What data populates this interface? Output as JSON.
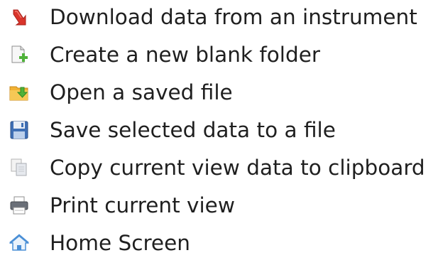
{
  "menu": {
    "items": [
      {
        "label": "Download data from an instrument",
        "icon": "download-arrow-icon"
      },
      {
        "label": "Create a new blank folder",
        "icon": "new-document-icon"
      },
      {
        "label": "Open a saved file",
        "icon": "open-folder-icon"
      },
      {
        "label": "Save selected data to a file",
        "icon": "floppy-disk-icon"
      },
      {
        "label": "Copy current view data to clipboard",
        "icon": "copy-icon"
      },
      {
        "label": "Print current view",
        "icon": "printer-icon"
      },
      {
        "label": "Home Screen",
        "icon": "home-icon"
      }
    ]
  },
  "colors": {
    "text": "#1f1f1f",
    "download_red": "#d9342b",
    "folder_orange": "#f2b233",
    "arrow_green": "#4fb23a",
    "floppy_blue": "#3f6fb5",
    "home_blue": "#4a8fd6"
  }
}
